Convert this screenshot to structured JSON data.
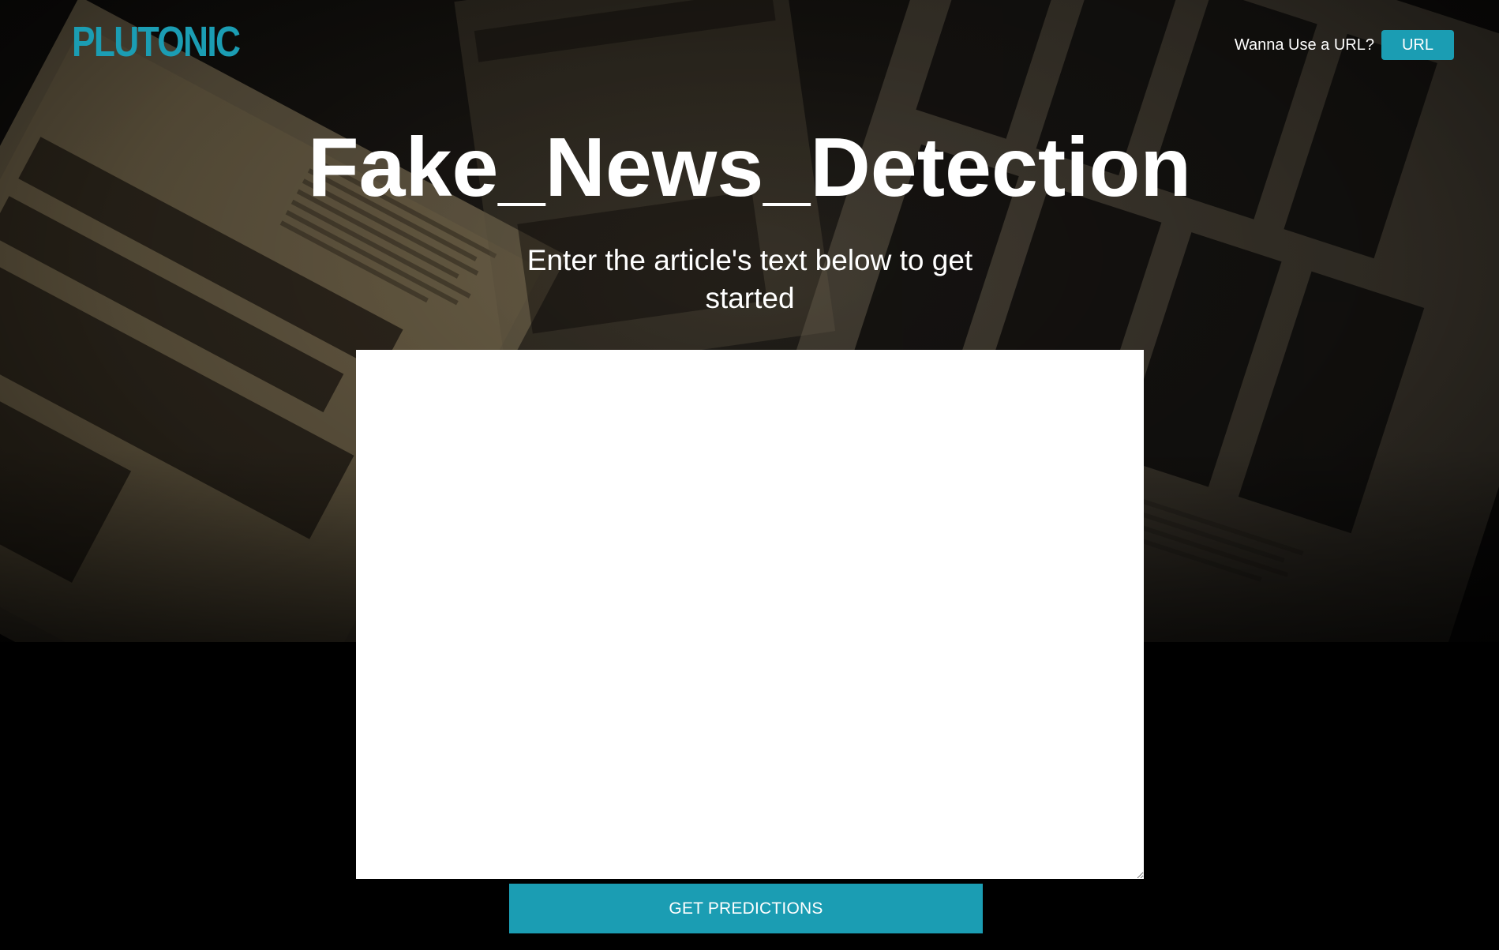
{
  "header": {
    "logo_text": "PLUTONIC",
    "url_prompt": "Wanna Use a URL?",
    "url_button_label": "URL"
  },
  "hero": {
    "title": "Fake_News_Detection",
    "subtitle": "Enter the article's text below to get started"
  },
  "form": {
    "article_text_value": "",
    "submit_label": "GET PREDICTIONS"
  },
  "colors": {
    "accent": "#1b9db3",
    "page_background": "#000000",
    "text": "#ffffff"
  }
}
